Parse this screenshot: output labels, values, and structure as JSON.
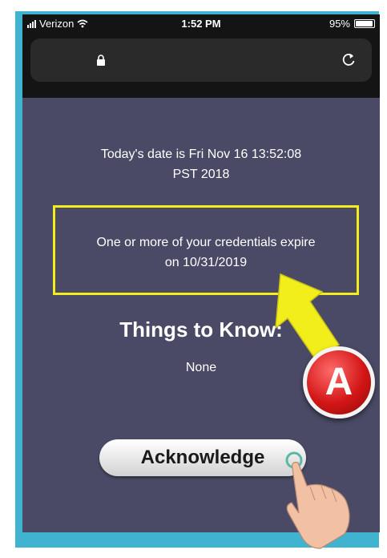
{
  "status_bar": {
    "carrier": "Verizon",
    "time": "1:52 PM",
    "battery": "95%"
  },
  "browser": {
    "lock_icon": "lock-icon",
    "reload_icon": "reload-icon"
  },
  "content": {
    "date_line1": "Today's date is Fri Nov 16 13:52:08",
    "date_line2": "PST 2018",
    "credentials_line1": "One or more of your credentials expire",
    "credentials_line2": "on 10/31/2019",
    "things_title": "Things to Know:",
    "things_value": "None",
    "acknowledge_label": "Acknowledge"
  },
  "annotation": {
    "badge_letter": "A",
    "highlight_color": "#f2ee1c",
    "badge_color": "#d31616"
  },
  "colors": {
    "background": "#4a4a66",
    "frame": "#3fb3cf",
    "toolbar": "#141414"
  }
}
